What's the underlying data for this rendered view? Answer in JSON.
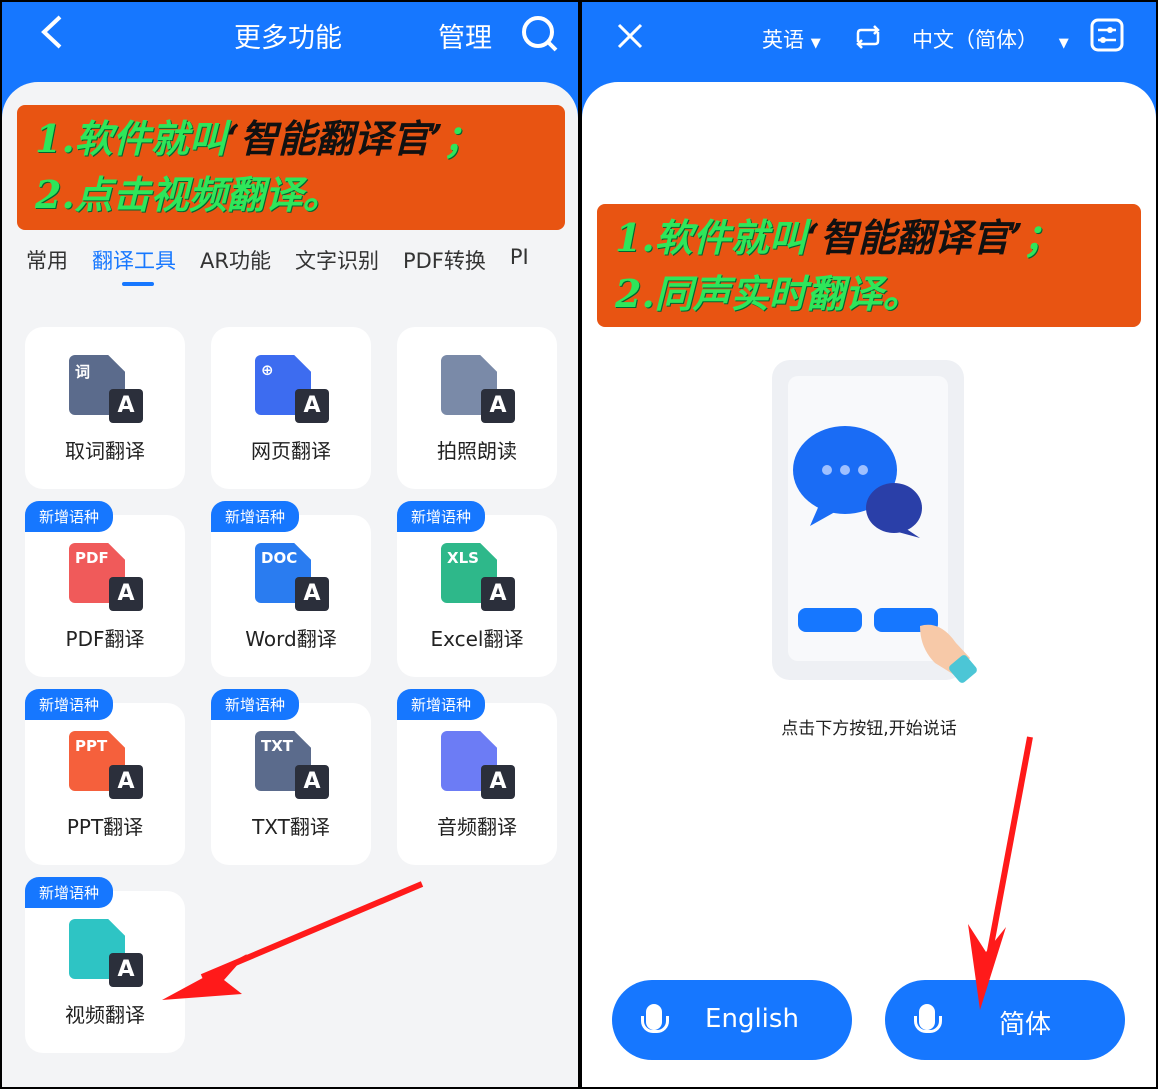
{
  "left": {
    "title": "更多功能",
    "manage": "管理",
    "banner": {
      "line1_a": "1.软件就叫",
      "line1_b": "‘智能翻译官’",
      "line1_c": "；",
      "line2": "2.点击视频翻译。"
    },
    "tabs": [
      {
        "label": "常用"
      },
      {
        "label": "翻译工具",
        "active": true
      },
      {
        "label": "AR功能"
      },
      {
        "label": "文字识别"
      },
      {
        "label": "PDF转换"
      },
      {
        "label": "PI"
      }
    ],
    "tools": [
      {
        "label": "取词翻译",
        "icon": "word-lookup-icon",
        "tag": "词",
        "color": "#5b6b8c"
      },
      {
        "label": "网页翻译",
        "icon": "web-translate-icon",
        "tag": "⊕",
        "color": "#3d6cf0"
      },
      {
        "label": "拍照朗读",
        "icon": "photo-read-icon",
        "tag": "",
        "color": "#7a8aa8"
      },
      {
        "label": "PDF翻译",
        "icon": "pdf-icon",
        "tag": "PDF",
        "color": "#f05a5a",
        "badge": "新增语种"
      },
      {
        "label": "Word翻译",
        "icon": "word-doc-icon",
        "tag": "DOC",
        "color": "#2a7cf0",
        "badge": "新增语种"
      },
      {
        "label": "Excel翻译",
        "icon": "excel-icon",
        "tag": "XLS",
        "color": "#2eb88a",
        "badge": "新增语种"
      },
      {
        "label": "PPT翻译",
        "icon": "ppt-icon",
        "tag": "PPT",
        "color": "#f5603c",
        "badge": "新增语种"
      },
      {
        "label": "TXT翻译",
        "icon": "txt-icon",
        "tag": "TXT",
        "color": "#5b6b8c",
        "badge": "新增语种"
      },
      {
        "label": "音频翻译",
        "icon": "audio-translate-icon",
        "tag": "",
        "color": "#6c7cf5",
        "badge": "新增语种"
      },
      {
        "label": "视频翻译",
        "icon": "video-translate-icon",
        "tag": "",
        "color": "#2ec4c4",
        "badge": "新增语种"
      }
    ]
  },
  "right": {
    "source_lang": "英语",
    "target_lang": "中文（简体）",
    "banner": {
      "line1_a": "1.软件就叫",
      "line1_b": "‘智能翻译官’",
      "line1_c": "；",
      "line2": "2.同声实时翻译。"
    },
    "hint": "点击下方按钮,开始说话",
    "btn_left": "English",
    "btn_right": "简体"
  },
  "colors": {
    "brand": "#1677ff",
    "banner": "#e85412",
    "banner_text": "#2ee65a",
    "arrow": "#ff1a1a"
  }
}
